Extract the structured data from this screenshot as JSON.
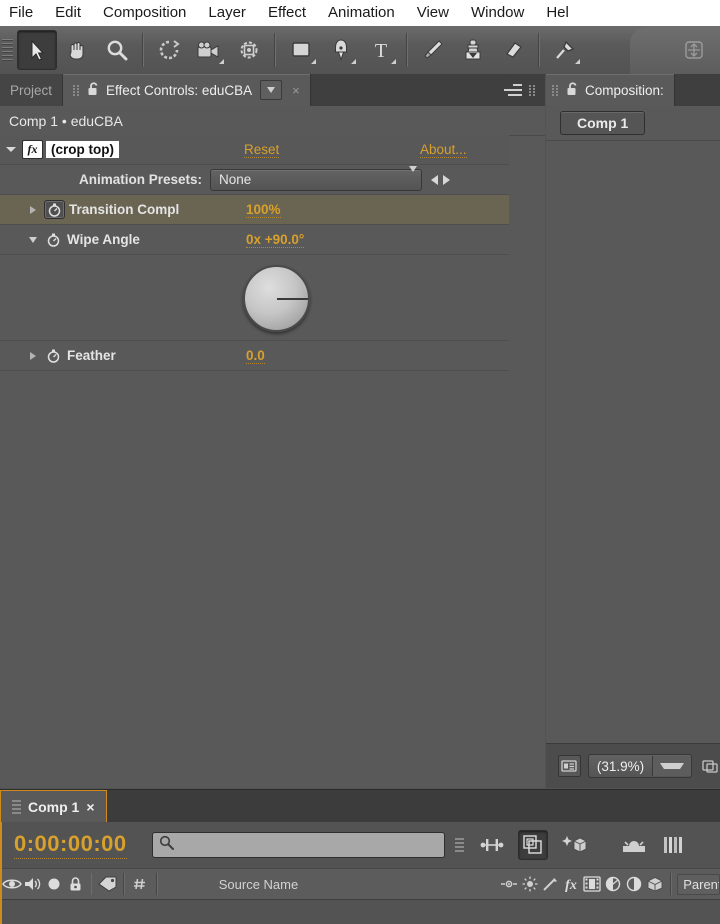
{
  "menubar": {
    "items": [
      {
        "label": "File"
      },
      {
        "label": "Edit"
      },
      {
        "label": "Composition"
      },
      {
        "label": "Layer"
      },
      {
        "label": "Effect"
      },
      {
        "label": "Animation"
      },
      {
        "label": "View"
      },
      {
        "label": "Window"
      },
      {
        "label": "Hel"
      }
    ]
  },
  "toolbar": {
    "tools": [
      {
        "name": "selection-tool",
        "active": true
      },
      {
        "name": "hand-tool",
        "active": false
      },
      {
        "name": "zoom-tool",
        "active": false
      },
      {
        "name": "rotation-tool",
        "active": false
      },
      {
        "name": "camera-tool",
        "active": false
      },
      {
        "name": "pan-behind-tool",
        "active": false
      },
      {
        "name": "shape-tool",
        "active": false
      },
      {
        "name": "pen-tool",
        "active": false
      },
      {
        "name": "type-tool",
        "active": false
      },
      {
        "name": "brush-tool",
        "active": false
      },
      {
        "name": "clone-stamp-tool",
        "active": false
      },
      {
        "name": "eraser-tool",
        "active": false
      },
      {
        "name": "puppet-pin-tool",
        "active": false
      },
      {
        "name": "anchor-tool",
        "active": false
      }
    ]
  },
  "effect_controls": {
    "tabs": {
      "project_label": "Project",
      "active_label": "Effect Controls: eduCBA",
      "close_glyph": "×"
    },
    "breadcrumb": "Comp 1 • eduCBA",
    "effect": {
      "name": "(crop top)",
      "reset_label": "Reset",
      "about_label": "About..."
    },
    "animation_presets": {
      "label": "Animation Presets:",
      "value": "None"
    },
    "properties": [
      {
        "name": "Transition Compl",
        "value": "100%",
        "highlighted": true
      },
      {
        "name": "Wipe Angle",
        "value": "0x +90.0°",
        "highlighted": false,
        "dial_degrees": 0
      },
      {
        "name": "Feather",
        "value": "0.0",
        "highlighted": false
      }
    ]
  },
  "composition": {
    "tab_label": "Composition:",
    "comp_chip": "Comp 1",
    "zoom_level": "(31.9%)"
  },
  "timeline": {
    "tab_label": "Comp 1",
    "close_glyph": "×",
    "timecode": "0:00:00:00",
    "search_placeholder": "",
    "columns": {
      "source_name": "Source Name",
      "parent": "Parent"
    }
  },
  "colors": {
    "accent_orange": "#d8a02c",
    "panel_bg": "#595959",
    "chrome_bg": "#535353",
    "tab_active": "#5a5a5a",
    "highlight_row": "#6a6453",
    "timeline_border": "#d08a1e"
  }
}
